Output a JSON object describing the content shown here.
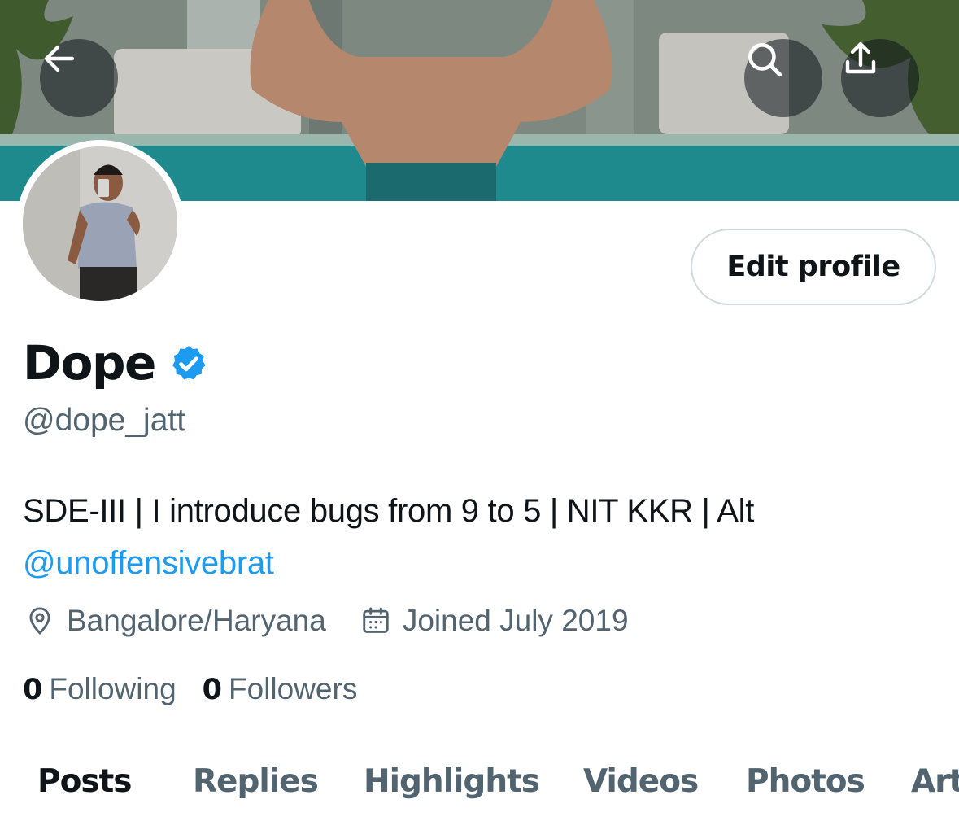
{
  "header": {
    "back_icon": "arrow-left-icon",
    "search_icon": "search-icon",
    "share_icon": "share-icon"
  },
  "profile": {
    "edit_label": "Edit profile",
    "display_name": "Dope",
    "verified": true,
    "verified_color": "#1d9bf0",
    "handle": "@dope_jatt",
    "bio_text": "SDE-III | I introduce bugs from 9 to 5 | NIT KKR | Alt",
    "bio_mention": "@unoffensivebrat",
    "location": "Bangalore/Haryana",
    "joined": "Joined July 2019",
    "following_count": "0",
    "following_label": "Following",
    "followers_count": "0",
    "followers_label": "Followers"
  },
  "tabs": [
    {
      "label": "Posts",
      "active": true
    },
    {
      "label": "Replies",
      "active": false
    },
    {
      "label": "Highlights",
      "active": false
    },
    {
      "label": "Videos",
      "active": false
    },
    {
      "label": "Photos",
      "active": false
    },
    {
      "label": "Articles",
      "active": false
    }
  ],
  "colors": {
    "text_primary": "#0f1419",
    "text_secondary": "#536471",
    "link": "#1d9bf0",
    "border": "#cfd9de"
  }
}
